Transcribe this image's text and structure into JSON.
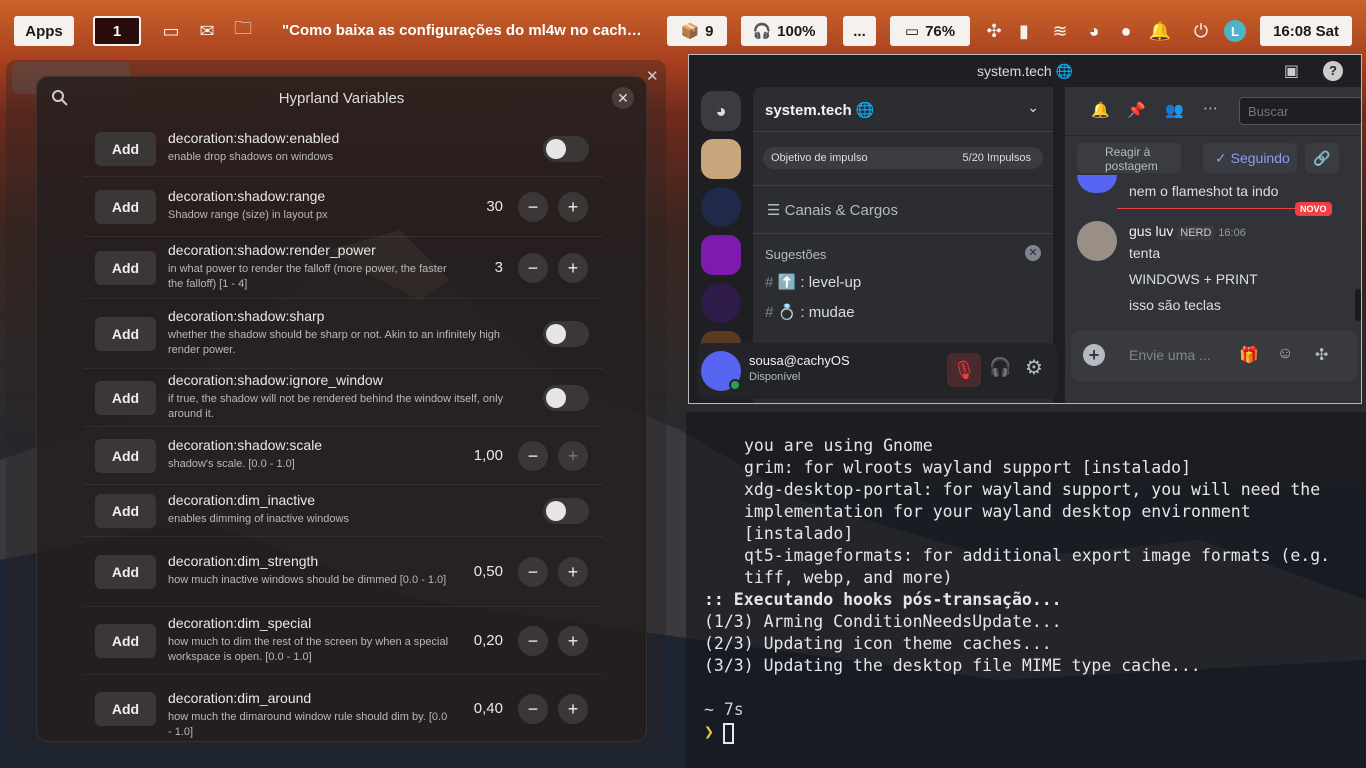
{
  "topbar": {
    "apps_label": "Apps",
    "workspace": "1",
    "window_title": "\"Como baixa as configurações do ml4w no cachy...",
    "packages": "9",
    "volume": "100%",
    "more": "...",
    "battery": "76%",
    "clock": "16:08 Sat"
  },
  "hyprland": {
    "title": "Hyprland Variables",
    "add_label": "Add",
    "rows": [
      {
        "name": "decoration:shadow:enabled",
        "desc": "enable drop shadows on windows",
        "kind": "toggle"
      },
      {
        "name": "decoration:shadow:range",
        "desc": "Shadow range (size) in layout px",
        "kind": "number",
        "value": "30"
      },
      {
        "name": "decoration:shadow:render_power",
        "desc": "in what power to render the falloff (more power, the faster the falloff) [1 - 4]",
        "kind": "number",
        "value": "3"
      },
      {
        "name": "decoration:shadow:sharp",
        "desc": "whether the shadow should be sharp or not. Akin to an infinitely high render power.",
        "kind": "toggle"
      },
      {
        "name": "decoration:shadow:ignore_window",
        "desc": "if true, the shadow will not be rendered behind the window itself, only around it.",
        "kind": "toggle"
      },
      {
        "name": "decoration:shadow:scale",
        "desc": "shadow's scale. [0.0 - 1.0]",
        "kind": "number",
        "value": "1,00"
      },
      {
        "name": "decoration:dim_inactive",
        "desc": "enables dimming of inactive windows",
        "kind": "toggle"
      },
      {
        "name": "decoration:dim_strength",
        "desc": "how much inactive windows should be dimmed [0.0 - 1.0]",
        "kind": "number",
        "value": "0,50"
      },
      {
        "name": "decoration:dim_special",
        "desc": "how much to dim the rest of the screen by when a special workspace is open. [0.0 - 1.0]",
        "kind": "number",
        "value": "0,20"
      },
      {
        "name": "decoration:dim_around",
        "desc": "how much the dimaround window rule should dim by. [0.0 - 1.0]",
        "kind": "number",
        "value": "0,40"
      }
    ]
  },
  "discord": {
    "window_title": "system.tech 🌐",
    "server_name": "system.tech 🌐",
    "boost_label": "Objetivo de impulso",
    "boost_count": "5/20 Impulsos",
    "channels_roles": "Canais & Cargos",
    "suggestions": "Sugestões",
    "channels": [
      {
        "label": "⬆️ : level-up"
      },
      {
        "label": "💍 : mudae"
      }
    ],
    "user": {
      "name": "sousa@cachyOS",
      "status": "Disponível"
    },
    "search_placeholder": "Buscar",
    "react_label": "Reagir à postagem",
    "following_label": "Seguindo",
    "prev_msg": "nem o flameshot ta indo",
    "new_badge": "NOVO",
    "msg_author": "gus luv",
    "msg_tag": "NERD",
    "msg_time": "16:06",
    "msg_lines": [
      "tenta",
      "WINDOWS + PRINT",
      "isso são teclas"
    ],
    "input_placeholder": "Envie uma ..."
  },
  "terminal": {
    "lines": [
      {
        "text": "you are using Gnome",
        "indent": true
      },
      {
        "text": "grim: for wlroots wayland support [instalado]",
        "indent": true
      },
      {
        "text": "xdg-desktop-portal: for wayland support, you will need the",
        "indent": true
      },
      {
        "text": "implementation for your wayland desktop environment",
        "indent": true
      },
      {
        "text": "[instalado]",
        "indent": true
      },
      {
        "text": "qt5-imageformats: for additional export image formats (e.g.",
        "indent": true
      },
      {
        "text": "tiff, webp, and more)",
        "indent": true
      },
      {
        "text": ":: Executando hooks pós-transação...",
        "indent": false,
        "bold": true
      },
      {
        "text": "(1/3) Arming ConditionNeedsUpdate...",
        "indent": false
      },
      {
        "text": "(2/3) Updating icon theme caches...",
        "indent": false
      },
      {
        "text": "(3/3) Updating the desktop file MIME type cache...",
        "indent": false
      }
    ],
    "prompt_dir": "~ 7s",
    "prompt_symbol": "❯"
  }
}
